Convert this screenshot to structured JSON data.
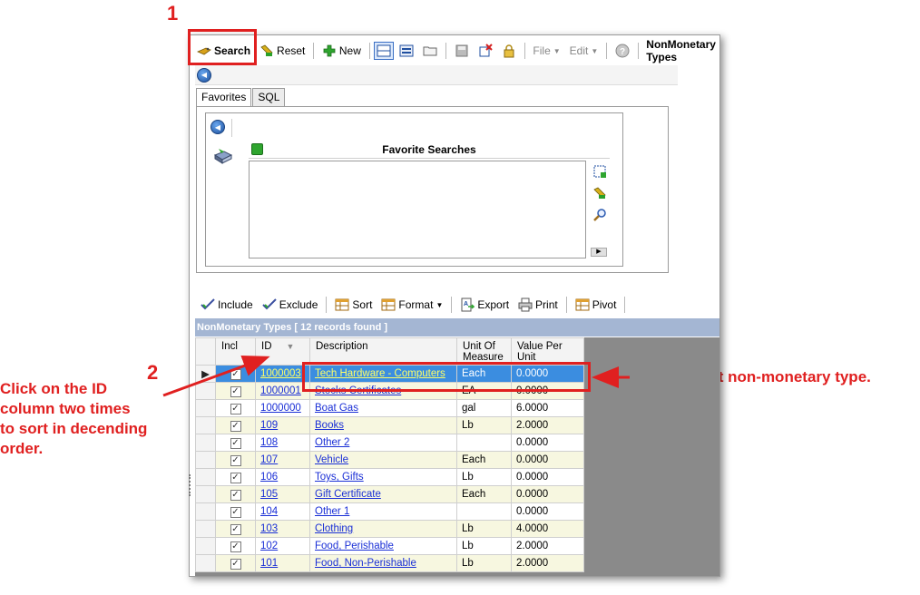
{
  "callouts": {
    "step1_number": "1",
    "step2_number": "2",
    "step2_text_lines": [
      "Click on the ID",
      "column two times",
      "to sort in decending",
      "order."
    ],
    "recent_note": "Most recent non-monetary type."
  },
  "toolbar": {
    "search_label": "Search",
    "reset_label": "Reset",
    "new_label": "New",
    "file_label": "File",
    "edit_label": "Edit",
    "window_title": "NonMonetary Types"
  },
  "tabs": [
    {
      "label": "Favorites",
      "active": true
    },
    {
      "label": "SQL",
      "active": false
    }
  ],
  "favorites": {
    "title": "Favorite Searches"
  },
  "grid_toolbar": {
    "include_label": "Include",
    "exclude_label": "Exclude",
    "sort_label": "Sort",
    "format_label": "Format",
    "export_label": "Export",
    "print_label": "Print",
    "pivot_label": "Pivot"
  },
  "section_header": "NonMonetary Types [ 12 records found ]",
  "grid": {
    "columns": [
      "Incl",
      "ID",
      "Description",
      "Unit Of Measure",
      "Value Per Unit"
    ],
    "rows": [
      {
        "incl": true,
        "id": "1000003",
        "description": "Tech Hardware - Computers",
        "uom": "Each",
        "value": "0.0000",
        "selected": true
      },
      {
        "incl": true,
        "id": "1000001",
        "description": "Stocks Certificates",
        "uom": "EA",
        "value": "0.0000"
      },
      {
        "incl": true,
        "id": "1000000",
        "description": "Boat Gas",
        "uom": "gal",
        "value": "6.0000"
      },
      {
        "incl": true,
        "id": "109",
        "description": "Books",
        "uom": "Lb",
        "value": "2.0000"
      },
      {
        "incl": true,
        "id": "108",
        "description": "Other 2",
        "uom": "",
        "value": "0.0000"
      },
      {
        "incl": true,
        "id": "107",
        "description": "Vehicle",
        "uom": "Each",
        "value": "0.0000"
      },
      {
        "incl": true,
        "id": "106",
        "description": "Toys, Gifts",
        "uom": "Lb",
        "value": "0.0000"
      },
      {
        "incl": true,
        "id": "105",
        "description": "Gift Certificate",
        "uom": "Each",
        "value": "0.0000"
      },
      {
        "incl": true,
        "id": "104",
        "description": "Other 1",
        "uom": "",
        "value": "0.0000"
      },
      {
        "incl": true,
        "id": "103",
        "description": "Clothing",
        "uom": "Lb",
        "value": "4.0000"
      },
      {
        "incl": true,
        "id": "102",
        "description": "Food, Perishable",
        "uom": "Lb",
        "value": "2.0000"
      },
      {
        "incl": true,
        "id": "101",
        "description": "Food, Non-Perishable",
        "uom": "Lb",
        "value": "2.0000"
      }
    ]
  },
  "colors": {
    "callout_red": "#e02020",
    "selection_blue": "#3b8de0",
    "header_band": "#a4b6d3",
    "link_blue": "#1a2fd6",
    "alt_row": "#f7f7e0"
  }
}
